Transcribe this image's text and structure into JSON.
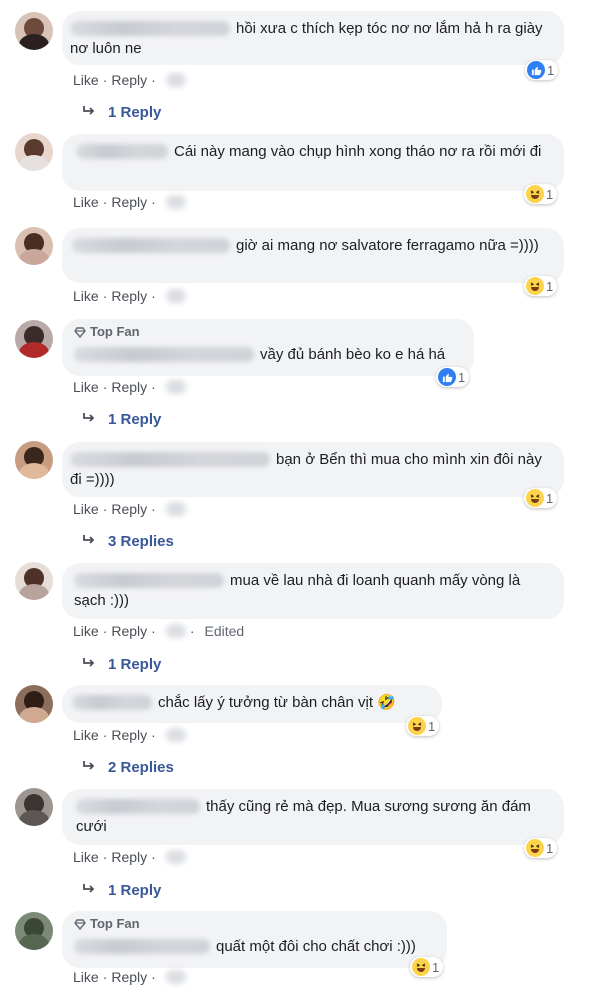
{
  "comments": [
    {
      "text": "hồi xưa c thích kẹp tóc nơ nơ lắm hả h ra giày nơ luôn ne",
      "actions": [
        "Like",
        "Reply"
      ],
      "reaction": {
        "type": "like",
        "count": "1"
      },
      "replies": "1 Reply"
    },
    {
      "text": "Cái này mang vào chụp hình xong tháo nơ ra rồi mới đi",
      "actions": [
        "Like",
        "Reply"
      ],
      "reaction": {
        "type": "haha",
        "count": "1"
      }
    },
    {
      "text": "giờ ai mang nơ salvatore ferragamo nữa =))))",
      "actions": [
        "Like",
        "Reply"
      ],
      "reaction": {
        "type": "haha",
        "count": "1"
      }
    },
    {
      "badge": "Top Fan",
      "text": "vầy đủ bánh bèo ko e há há",
      "actions": [
        "Like",
        "Reply"
      ],
      "reaction": {
        "type": "like",
        "count": "1"
      },
      "replies": "1 Reply"
    },
    {
      "text": "bạn ở Bển thì mua cho mình xin đôi này đi =))))",
      "actions": [
        "Like",
        "Reply"
      ],
      "reaction": {
        "type": "haha",
        "count": "1"
      },
      "replies": "3 Replies"
    },
    {
      "text": "mua về lau nhà đi loanh quanh mấy vòng là sạch :)))",
      "actions": [
        "Like",
        "Reply"
      ],
      "edited": "Edited",
      "replies": "1 Reply"
    },
    {
      "text": "chắc lấy ý tưởng từ bàn chân vịt 🤣",
      "actions": [
        "Like",
        "Reply"
      ],
      "reaction": {
        "type": "haha",
        "count": "1"
      },
      "replies": "2 Replies"
    },
    {
      "text": "thấy cũng rẻ mà đẹp. Mua sương sương ăn đám cưới",
      "actions": [
        "Like",
        "Reply"
      ],
      "reaction": {
        "type": "haha",
        "count": "1"
      },
      "replies": "1 Reply"
    },
    {
      "badge": "Top Fan",
      "text": "quất một đôi cho chất chơi :)))",
      "actions": [
        "Like",
        "Reply"
      ],
      "reaction": {
        "type": "haha",
        "count": "1"
      }
    }
  ],
  "colors": {
    "bubble": "#f2f3f5",
    "link": "#385898",
    "meta": "#4b4f56",
    "like_blue": "#2f7ff3",
    "haha_yellow": "#fcd34a"
  }
}
